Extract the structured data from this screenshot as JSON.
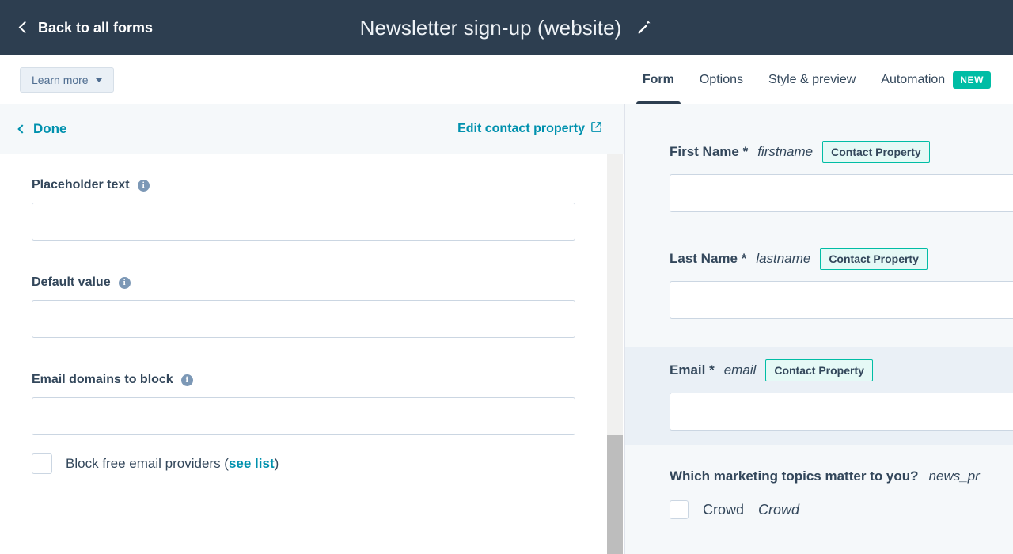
{
  "header": {
    "back_label": "Back to all forms",
    "back_icon": "chevron-left-icon",
    "title": "Newsletter sign-up (website)",
    "edit_icon": "pencil-icon",
    "background_color": "#2d3e50"
  },
  "nav": {
    "learn_more_label": "Learn more",
    "learn_more_caret": "chevron-down-icon",
    "tabs": [
      {
        "label": "Form",
        "active": true
      },
      {
        "label": "Options",
        "active": false
      },
      {
        "label": "Style & preview",
        "active": false
      },
      {
        "label": "Automation",
        "active": false,
        "badge": "NEW"
      }
    ],
    "badge_color": "#00bda5",
    "active_underline_color": "#2d3e50"
  },
  "editor": {
    "done_label": "Done",
    "done_icon": "chevron-left-icon",
    "edit_property_label": "Edit contact property",
    "edit_property_icon": "external-link-icon",
    "link_color": "#0091ae",
    "fields": [
      {
        "label": "Placeholder text",
        "info_icon": "info-circle-icon",
        "value": "",
        "placeholder": ""
      },
      {
        "label": "Default value",
        "info_icon": "info-circle-icon",
        "value": "",
        "placeholder": ""
      },
      {
        "label": "Email domains to block",
        "info_icon": "info-circle-icon",
        "value": "",
        "placeholder": ""
      }
    ],
    "block_free_providers": {
      "checked": false,
      "text_before": "Block free email providers (",
      "link_label": "see list",
      "text_after": ")"
    }
  },
  "preview": {
    "fields": [
      {
        "label": "First Name *",
        "internal_name": "firstname",
        "badge": "Contact Property",
        "value": "",
        "selected": false
      },
      {
        "label": "Last Name *",
        "internal_name": "lastname",
        "badge": "Contact Property",
        "value": "",
        "selected": false
      },
      {
        "label": "Email *",
        "internal_name": "email",
        "badge": "Contact Property",
        "value": "",
        "selected": true
      }
    ],
    "question": {
      "label": "Which marketing topics matter to you?",
      "internal_name": "news_pr",
      "options": [
        {
          "label": "Crowd",
          "internal_name": "Crowd",
          "checked": false
        }
      ]
    },
    "badge_border_color": "#00bda5",
    "selected_background": "#eaf0f6",
    "panel_background": "#f5f8fa"
  }
}
